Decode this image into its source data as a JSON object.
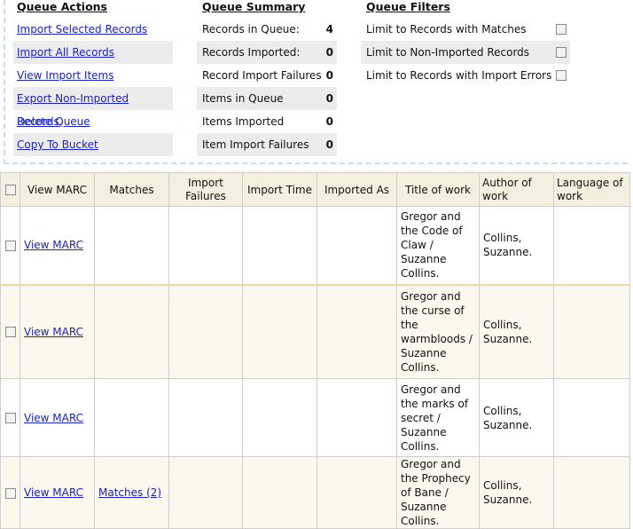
{
  "queue_actions": {
    "title": "Queue Actions",
    "items": [
      "Import Selected Records",
      "Import All Records",
      "View Import Items",
      "Export Non-Imported Records",
      "Delete Queue",
      "Copy To Bucket"
    ]
  },
  "queue_summary": {
    "title": "Queue Summary",
    "rows": [
      {
        "label": "Records in Queue:",
        "value": "4"
      },
      {
        "label": "Records Imported:",
        "value": "0"
      },
      {
        "label": "Record Import Failures",
        "value": "0"
      },
      {
        "label": "Items in Queue",
        "value": "0"
      },
      {
        "label": "Items Imported",
        "value": "0"
      },
      {
        "label": "Item Import Failures",
        "value": "0"
      }
    ]
  },
  "queue_filters": {
    "title": "Queue Filters",
    "rows": [
      "Limit to Records with Matches",
      "Limit to Non-Imported Records",
      "Limit to Records with Import Errors"
    ]
  },
  "grid": {
    "headers": {
      "view_marc": "View MARC",
      "matches": "Matches",
      "import_failures": "Import Failures",
      "import_time": "Import Time",
      "imported_as": "Imported As",
      "title": "Title of work",
      "author": "Author of work",
      "language": "Language of work"
    },
    "rows": [
      {
        "view_marc": "View MARC",
        "matches": "",
        "title": "Gregor and the Code of Claw / Suzanne Collins.",
        "author": "Collins, Suzanne."
      },
      {
        "view_marc": "View MARC",
        "matches": "",
        "title": "Gregor and the curse of the warmbloods / Suzanne Collins.",
        "author": "Collins, Suzanne."
      },
      {
        "view_marc": "View MARC",
        "matches": "",
        "title": "Gregor and the marks of secret / Suzanne Collins.",
        "author": "Collins, Suzanne."
      },
      {
        "view_marc": "View MARC",
        "matches": "Matches (2)",
        "title": "Gregor and the Prophecy of Bane / Suzanne Collins.",
        "author": "Collins, Suzanne."
      }
    ]
  }
}
